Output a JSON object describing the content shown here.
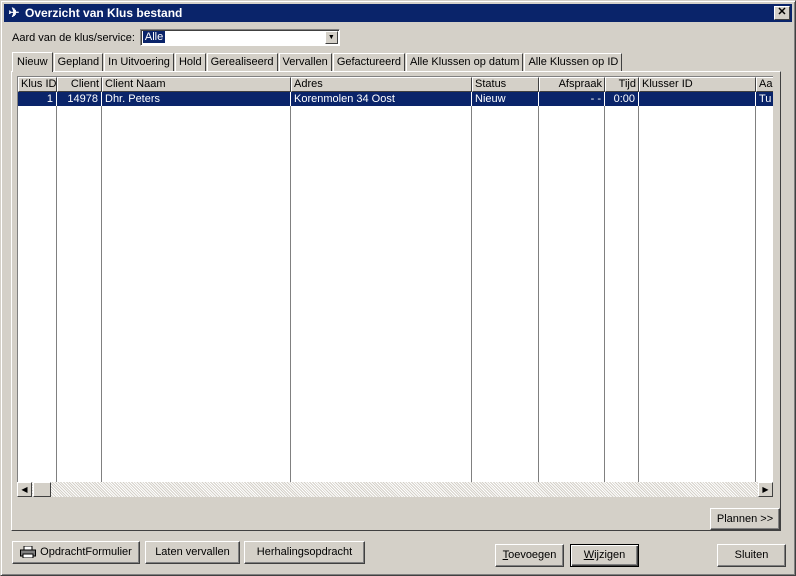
{
  "window": {
    "title": "Overzicht van Klus bestand",
    "close_glyph": "✕"
  },
  "filter": {
    "label": "Aard van de klus/service:",
    "selected": "Alle"
  },
  "tabs": [
    "Nieuw",
    "Gepland",
    "In Uitvoering",
    "Hold",
    "Gerealiseerd",
    "Vervallen",
    "Gefactureerd",
    "Alle Klussen op datum",
    "Alle Klussen op ID"
  ],
  "active_tab": "Nieuw",
  "table": {
    "columns": [
      "Klus ID",
      "Client",
      "Client Naam",
      "Adres",
      "Status",
      "Afspraak",
      "Tijd",
      "Klusser ID",
      "Aa"
    ],
    "rows": [
      [
        "1",
        "14978",
        "Dhr. Peters",
        "Korenmolen 34 Oost",
        "Nieuw",
        "- -",
        "0:00",
        "",
        "Tu"
      ]
    ]
  },
  "buttons": {
    "plannen": "Plannen >>",
    "opdrachtformulier": "OpdrachtFormulier",
    "laten_vervallen": "Laten vervallen",
    "herhalingsopdracht": "Herhalingsopdracht",
    "toevoegen_mn": "T",
    "toevoegen_rest": "oevoegen",
    "wijzigen_mn": "W",
    "wijzigen_rest": "ijzigen",
    "sluiten": "Sluiten"
  },
  "icons": {
    "app": "app-icon",
    "printer": "printer-icon",
    "scroll_left": "◀",
    "scroll_right": "▶",
    "dropdown": "▼"
  },
  "colors": {
    "titlebar": "#0a246a",
    "selection": "#0a246a",
    "face": "#d4d0c8"
  }
}
